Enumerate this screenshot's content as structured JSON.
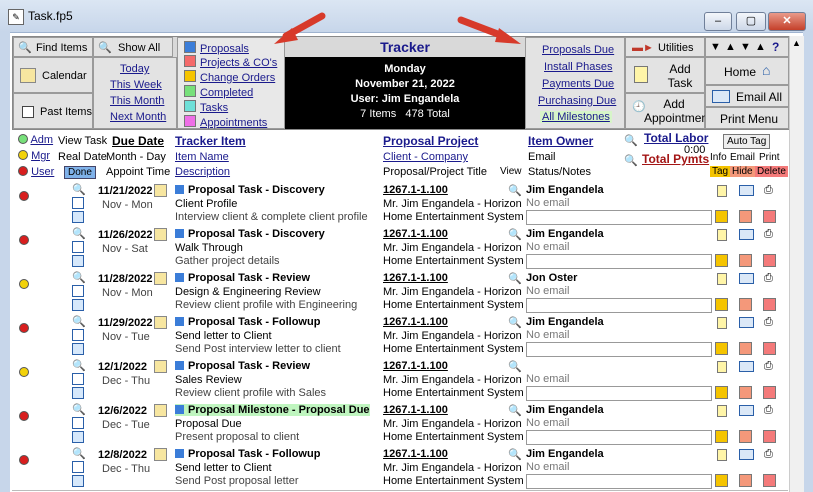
{
  "window": {
    "title": "Task.fp5",
    "minimize": "–",
    "maximize": "▢",
    "close": "✕"
  },
  "toolbar": {
    "find_items": "Find Items",
    "show_all": "Show All",
    "calendar": "Calendar",
    "past_items": "Past Items",
    "today": "Today",
    "this_week": "This Week",
    "this_month": "This Month",
    "next_month": "Next Month",
    "legend": [
      {
        "label": "Proposals",
        "color": "#3b7dd8"
      },
      {
        "label": "Projects & CO's",
        "color": "#f46a6a"
      },
      {
        "label": "Change Orders",
        "color": "#f5c400"
      },
      {
        "label": "Completed",
        "color": "#77e07a"
      },
      {
        "label": "Tasks",
        "color": "#6fe0d8"
      },
      {
        "label": "Appointments",
        "color": "#ee6fe6"
      }
    ],
    "tracker_title": "Tracker",
    "day": "Monday",
    "date": "November 21, 2022",
    "user": "User: Jim Engandela",
    "items_total": "7 Items   478 Total",
    "filters": [
      "Proposals Due",
      "Install Phases",
      "Payments Due",
      "Purchasing Due",
      "All Milestones"
    ],
    "utilities": "Utilities",
    "add_task": "Add Task",
    "add_appointment": "Add Appointment",
    "home": "Home",
    "email_all": "Email All",
    "print_menu": "Print Menu",
    "help": "?"
  },
  "columns": {
    "adm": "Adm",
    "mgr": "Mgr",
    "user": "User",
    "view_task": "View Task",
    "real_date": "Real Date",
    "done": "Done",
    "due_date": "Due Date",
    "month_day": "Month - Day",
    "appoint_time": "Appoint Time",
    "tracker_item": "Tracker Item",
    "item_name": "Item Name",
    "description": "Description",
    "proposal_project": "Proposal Project",
    "client_company": "Client - Company",
    "proposal_title": "Proposal/Project Title",
    "view": "View",
    "item_owner": "Item Owner",
    "email": "Email",
    "status_notes": "Status/Notes",
    "total_labor": "Total Labor",
    "labor_value": "0:00",
    "total_pymts": "Total Pymts",
    "auto_tag": "Auto Tag",
    "info": "Info",
    "email_col": "Email",
    "print": "Print",
    "tag": "Tag",
    "hide": "Hide",
    "delete": "Delete"
  },
  "rows": [
    {
      "dot": "#d81e1e",
      "date": "11/21/2022",
      "day": "Nov - Mon",
      "type": "Proposal Task - Discovery",
      "name": "Client Profile",
      "desc": "Interview client & complete client profile",
      "project": "1267.1-1.100",
      "client": "Mr. Jim Engandela - Horizon",
      "title": "Home Entertainment System",
      "owner": "Jim Engandela",
      "email": "No email",
      "highlight": false
    },
    {
      "dot": "#d81e1e",
      "date": "11/26/2022",
      "day": "Nov - Sat",
      "type": "Proposal Task - Discovery",
      "name": "Walk Through",
      "desc": "Gather project details",
      "project": "1267.1-1.100",
      "client": "Mr. Jim Engandela - Horizon",
      "title": "Home Entertainment System",
      "owner": "Jim Engandela",
      "email": "No email",
      "highlight": false
    },
    {
      "dot": "#f2d20a",
      "date": "11/28/2022",
      "day": "Nov - Mon",
      "type": "Proposal Task - Review",
      "name": "Design & Engineering Review",
      "desc": "Review client profile with Engineering",
      "project": "1267.1-1.100",
      "client": "Mr. Jim Engandela - Horizon",
      "title": "Home Entertainment System",
      "owner": "Jon Oster",
      "email": "No email",
      "highlight": false
    },
    {
      "dot": "#d81e1e",
      "date": "11/29/2022",
      "day": "Nov - Tue",
      "type": "Proposal Task - Followup",
      "name": "Send letter to Client",
      "desc": "Send Post interview letter to client",
      "project": "1267.1-1.100",
      "client": "Mr. Jim Engandela - Horizon",
      "title": "Home Entertainment System",
      "owner": "Jim Engandela",
      "email": "No email",
      "highlight": false
    },
    {
      "dot": "#f2d20a",
      "date": "12/1/2022",
      "day": "Dec - Thu",
      "type": "Proposal Task - Review",
      "name": "Sales Review",
      "desc": "Review client profile with Sales",
      "project": "1267.1-1.100",
      "client": "Mr. Jim Engandela - Horizon",
      "title": "Home Entertainment System",
      "owner": "",
      "email": "No email",
      "highlight": false
    },
    {
      "dot": "#d81e1e",
      "date": "12/6/2022",
      "day": "Dec - Tue",
      "type": "Proposal Milestone - Proposal Due",
      "name": "Proposal Due",
      "desc": "Present proposal to client",
      "project": "1267.1-1.100",
      "client": "Mr. Jim Engandela - Horizon",
      "title": "Home Entertainment System",
      "owner": "Jim Engandela",
      "email": "No email",
      "highlight": true
    },
    {
      "dot": "#d81e1e",
      "date": "12/8/2022",
      "day": "Dec - Thu",
      "type": "Proposal Task - Followup",
      "name": "Send letter to Client",
      "desc": "Send Post proposal letter",
      "project": "1267.1-1.100",
      "client": "Mr. Jim Engandela - Horizon",
      "title": "Home Entertainment System",
      "owner": "Jim Engandela",
      "email": "No email",
      "highlight": false
    }
  ]
}
